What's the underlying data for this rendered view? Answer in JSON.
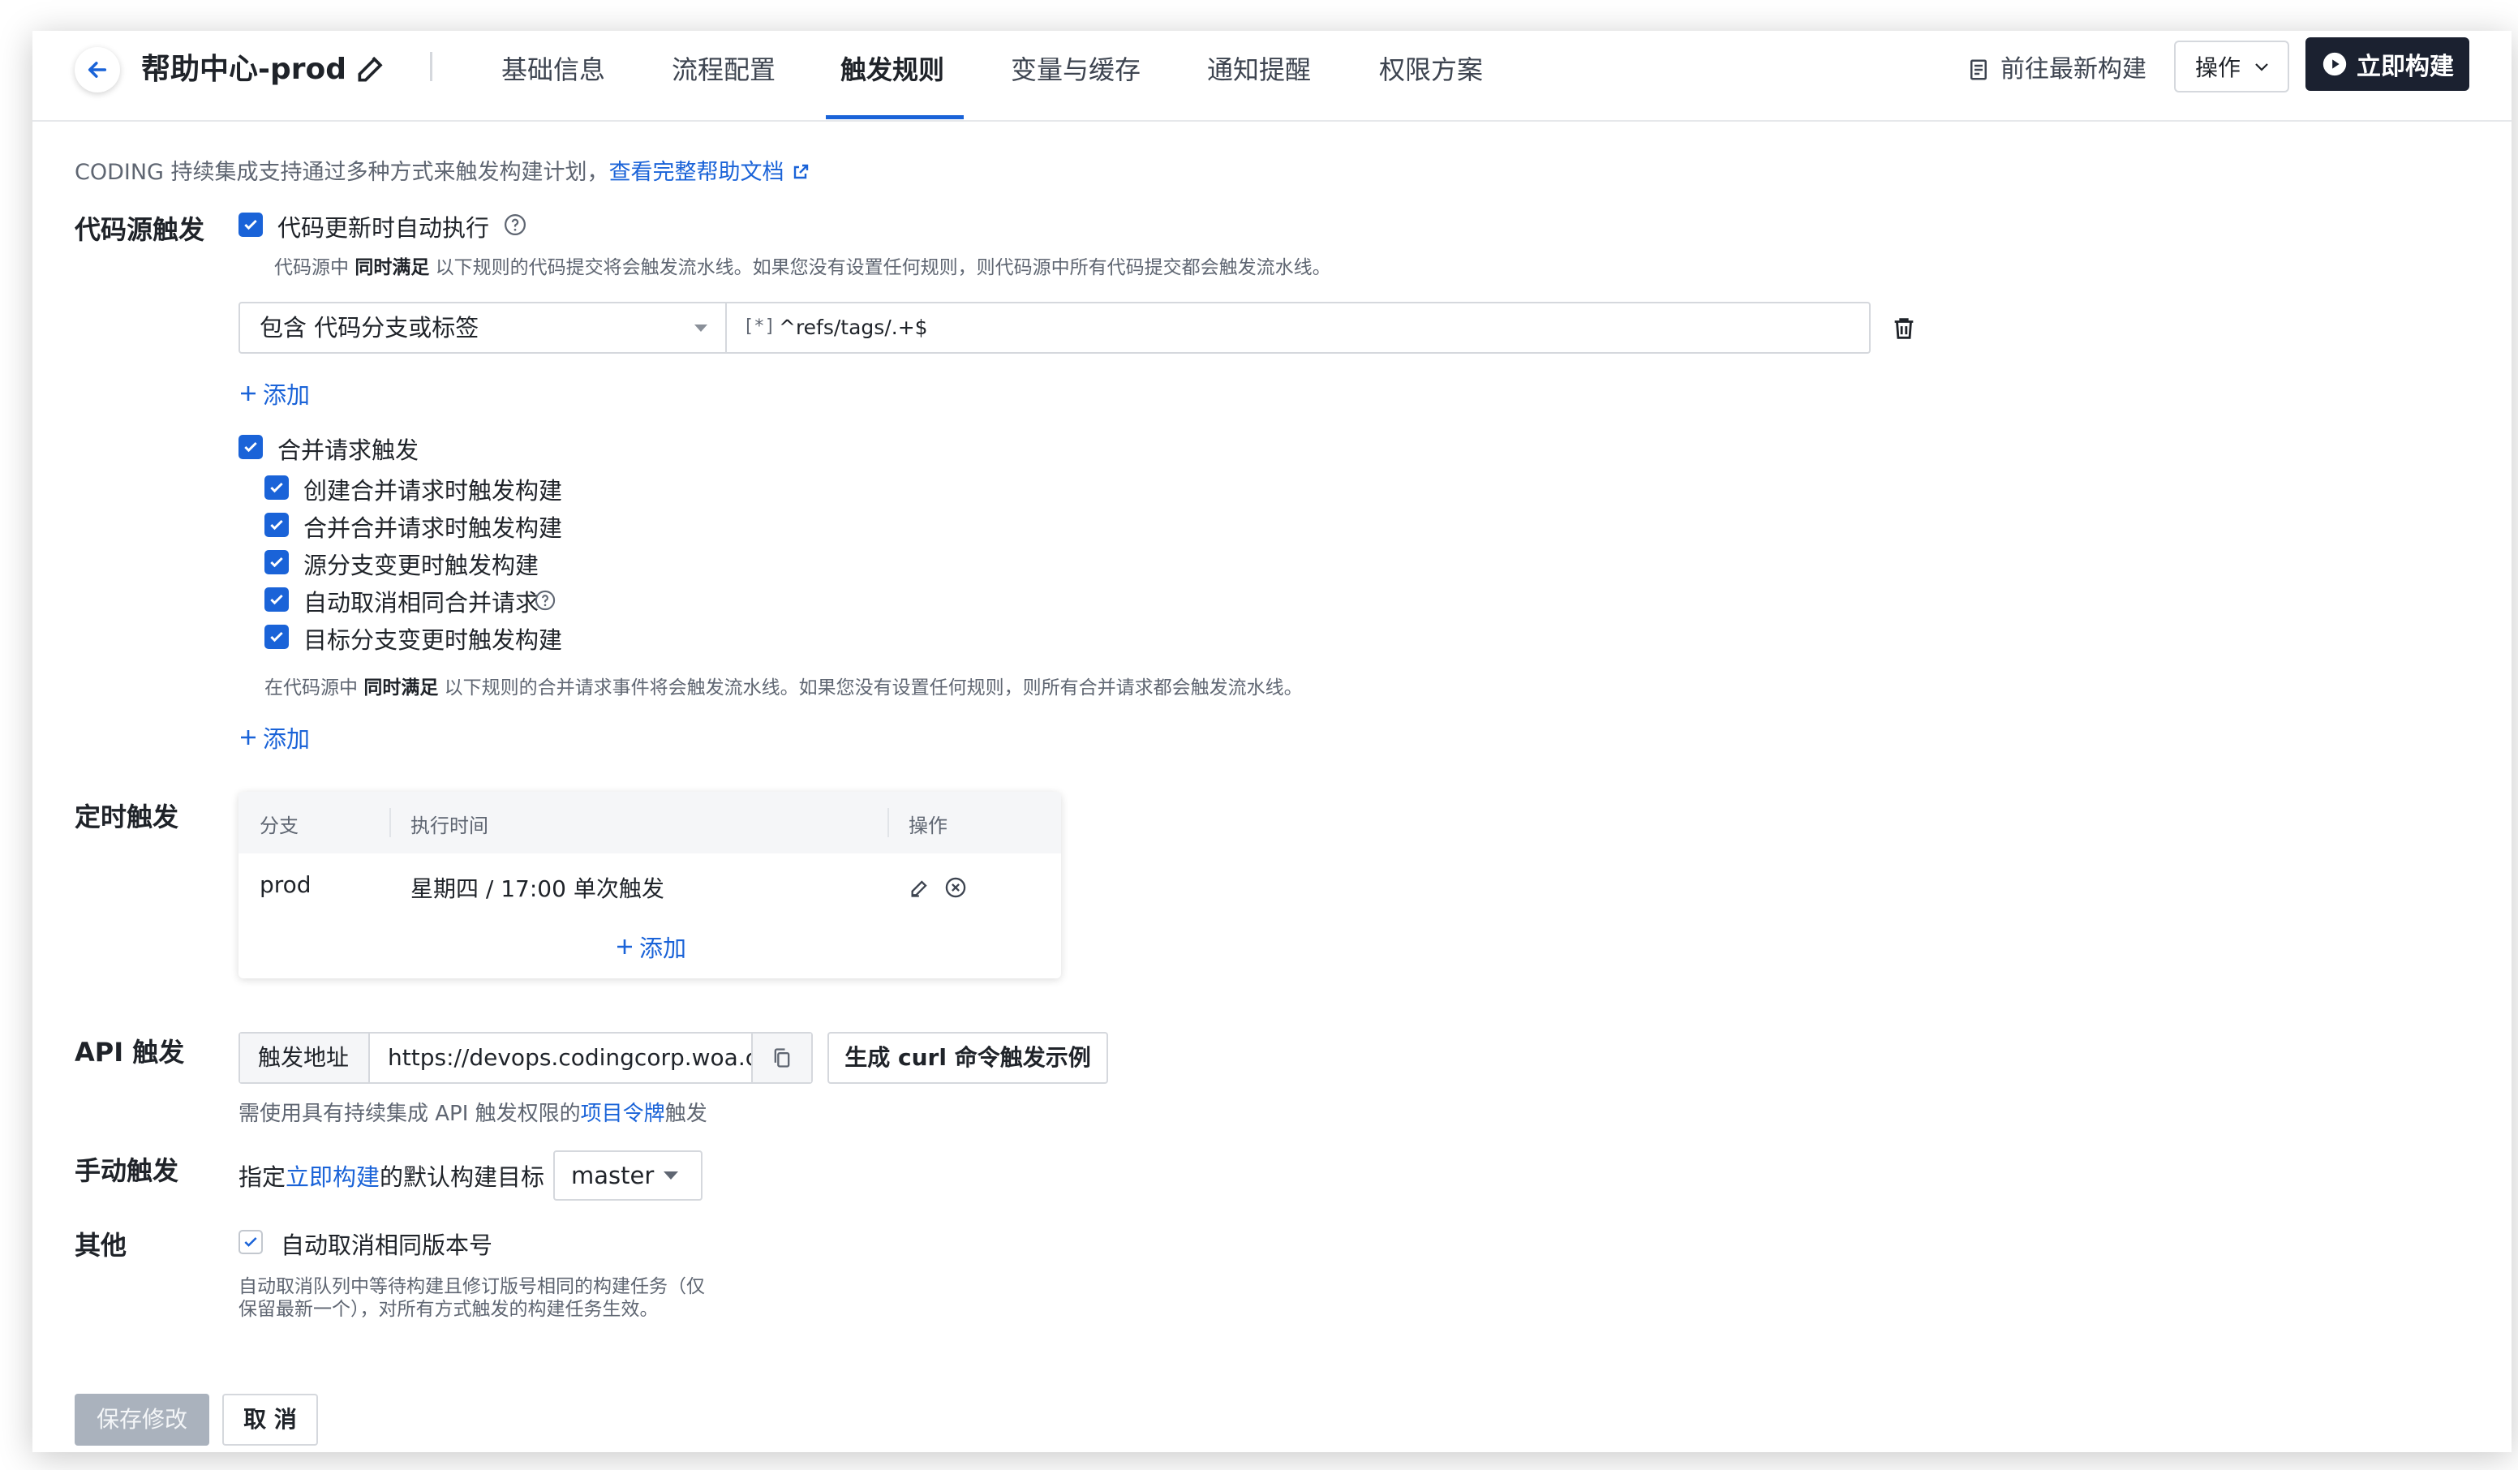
{
  "header": {
    "title": "帮助中心-prod",
    "tabs": [
      {
        "label": "基础信息"
      },
      {
        "label": "流程配置"
      },
      {
        "label": "触发规则"
      },
      {
        "label": "变量与缓存"
      },
      {
        "label": "通知提醒"
      },
      {
        "label": "权限方案"
      }
    ],
    "active_tab": "触发规则",
    "goto_latest_build": "前往最新构建",
    "ops_label": "操作",
    "build_now": "立即构建"
  },
  "intro": {
    "text": "CODING 持续集成支持通过多种方式来触发构建计划，",
    "link": "查看完整帮助文档"
  },
  "code_trigger": {
    "label": "代码源触发",
    "auto_run": {
      "label": "代码更新时自动执行",
      "checked": true,
      "desc_prefix": "代码源中",
      "desc_bold": "同时满足",
      "desc_suffix": "以下规则的代码提交将会触发流水线。如果您没有设置任何规则，则代码源中所有代码提交都会触发流水线。"
    },
    "rule": {
      "select_value": "包含 代码分支或标签",
      "regex_badge": "[*]",
      "value": "^refs/tags/.+$"
    },
    "add_label": "添加",
    "merge": {
      "label": "合并请求触发",
      "checked": true,
      "options": [
        {
          "label": "创建合并请求时触发构建",
          "checked": true
        },
        {
          "label": "合并合并请求时触发构建",
          "checked": true
        },
        {
          "label": "源分支变更时触发构建",
          "checked": true
        },
        {
          "label": "自动取消相同合并请求",
          "checked": true
        },
        {
          "label": "目标分支变更时触发构建",
          "checked": true
        }
      ],
      "desc_prefix": "在代码源中",
      "desc_bold": "同时满足",
      "desc_suffix": "以下规则的合并请求事件将会触发流水线。如果您没有设置任何规则，则所有合并请求都会触发流水线。"
    }
  },
  "schedule": {
    "label": "定时触发",
    "columns": [
      "分支",
      "执行时间",
      "操作"
    ],
    "rows": [
      {
        "branch": "prod",
        "time": "星期四 / 17:00 单次触发"
      }
    ],
    "add_label": "添加"
  },
  "api": {
    "label": "API 触发",
    "addon": "触发地址",
    "url": "https://devops.codingcorp.woa.com",
    "curl_button": "生成 curl 命令触发示例",
    "hint_prefix": "需使用具有持续集成 API 触发权限的",
    "hint_link": "项目令牌",
    "hint_suffix": "触发"
  },
  "manual": {
    "label": "手动触发",
    "text_prefix": "指定",
    "text_link": "立即构建",
    "text_suffix": "的默认构建目标",
    "target": "master"
  },
  "other": {
    "label": "其他",
    "option": "自动取消相同版本号",
    "checked": true,
    "desc_line1": "自动取消队列中等待构建且修订版号相同的构建任务（仅",
    "desc_line2": "保留最新一个），对所有方式触发的构建任务生效。"
  },
  "footer": {
    "save": "保存修改",
    "cancel": "取 消"
  },
  "colors": {
    "accent": "#1a63d8",
    "primary_dark": "#1b2130",
    "disabled": "#aab2bd"
  }
}
